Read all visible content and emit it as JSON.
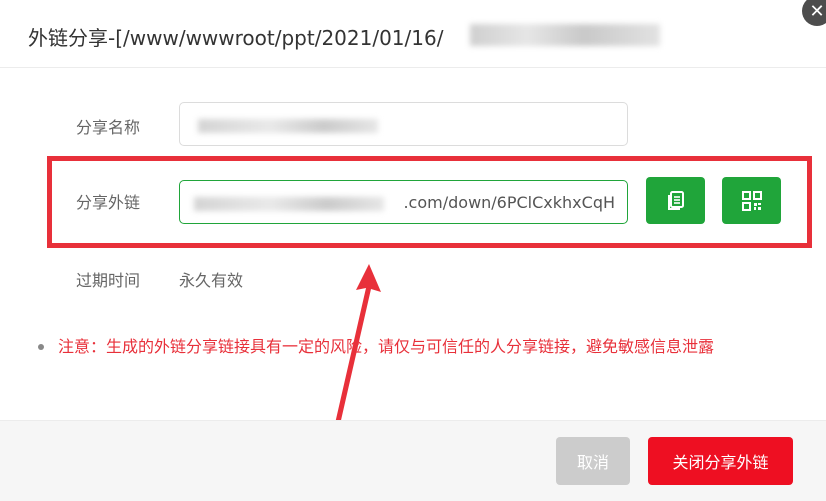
{
  "dialog": {
    "title": "外链分享-[/www/wwwroot/ppt/2021/01/16/"
  },
  "form": {
    "share_name": {
      "label": "分享名称"
    },
    "share_link": {
      "label": "分享外链",
      "value_suffix": ".com/down/6PClCxkhxCqH"
    },
    "expire": {
      "label": "过期时间",
      "value": "永久有效"
    }
  },
  "notice": {
    "text": "注意：生成的外链分享链接具有一定的风险，请仅与可信任的人分享链接，避免敏感信息泄露"
  },
  "footer": {
    "cancel_label": "取消",
    "close_share_label": "关闭分享外链"
  },
  "colors": {
    "primary_green": "#20a53a",
    "danger_red": "#ee0f22",
    "highlight_red": "#e8303a"
  },
  "icons": {
    "copy": "copy-icon",
    "qrcode": "qrcode-icon",
    "close": "close-icon"
  }
}
